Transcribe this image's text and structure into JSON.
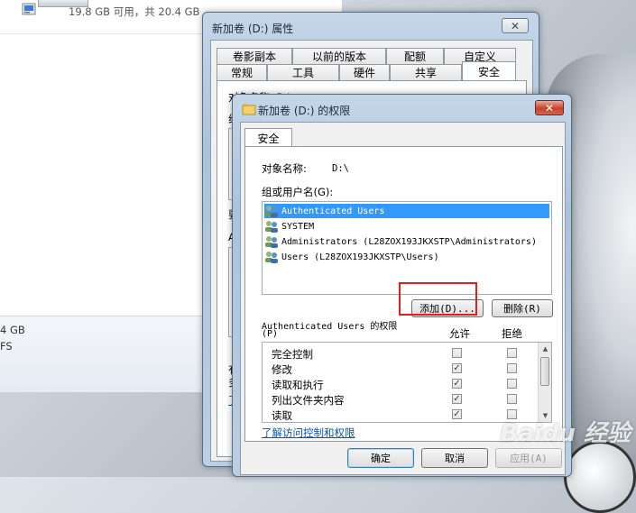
{
  "explorer": {
    "drive_size_text": "19.8 GB 可用，共 20.4 GB",
    "details_line1": "4 GB",
    "details_line2": "FS"
  },
  "properties_window": {
    "title": "新加卷 (D:) 属性",
    "tabs_row1": [
      "卷影副本",
      "以前的版本",
      "配额",
      "自定义"
    ],
    "tabs_row2": [
      "常规",
      "工具",
      "硬件",
      "共享",
      "安全"
    ],
    "active_tab": "安全",
    "frag_object": "对象名称:  D:\\",
    "frag_g": "组",
    "frag_c": "要",
    "frag_a": "A",
    "frag_y": "有",
    "frag_f": "多",
    "frag_link": "了"
  },
  "permissions_dialog": {
    "title": "新加卷 (D:) 的权限",
    "tab": "安全",
    "object_label": "对象名称:",
    "object_value": "D:\\",
    "group_label": "组或用户名(G):",
    "users": [
      "Authenticated Users",
      "SYSTEM",
      "Administrators (L28ZOX193JKXSTP\\Administrators)",
      "Users (L28ZOX193JKXSTP\\Users)"
    ],
    "add_button": "添加(D)...",
    "remove_button": "删除(R)",
    "perm_header": "Authenticated Users 的权限",
    "perm_header_key": "(P)",
    "allow_label": "允许",
    "deny_label": "拒绝",
    "permissions": [
      {
        "name": "完全控制",
        "allow": false,
        "deny": false
      },
      {
        "name": "修改",
        "allow": true,
        "deny": false
      },
      {
        "name": "读取和执行",
        "allow": true,
        "deny": false
      },
      {
        "name": "列出文件夹内容",
        "allow": true,
        "deny": false
      },
      {
        "name": "读取",
        "allow": true,
        "deny": false
      }
    ],
    "link_text": "了解访问控制和权限",
    "ok_button": "确定",
    "cancel_button": "取消",
    "apply_button": "应用(A)"
  },
  "watermark": "Baidu 经验"
}
